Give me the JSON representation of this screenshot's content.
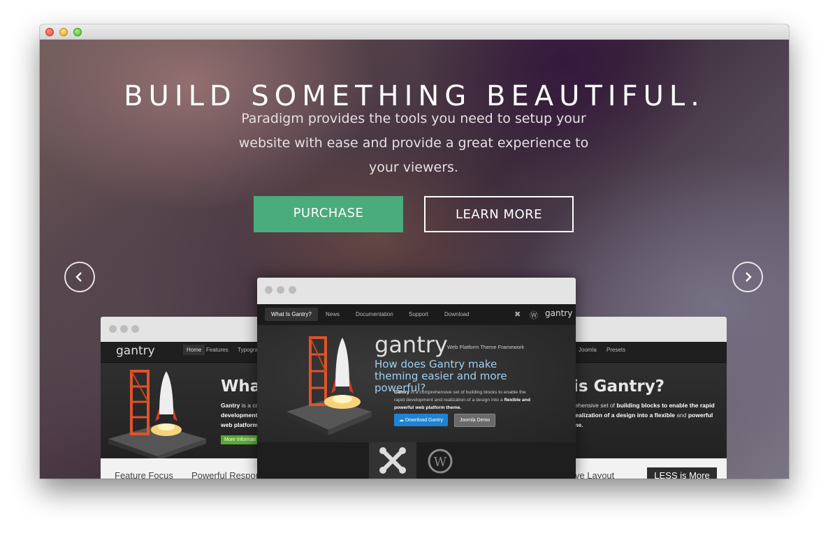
{
  "hero": {
    "headline": "BUILD SOMETHING BEAUTIFUL.",
    "subtext": "Paradigm provides the tools you need to setup your website with ease and provide a great experience to your viewers.",
    "purchase_label": "PURCHASE",
    "learn_more_label": "LEARN MORE",
    "prev_icon": "chevron-left-icon",
    "next_icon": "chevron-right-icon"
  },
  "colors": {
    "purchase_button": "#4aab7c",
    "headline_text": "#ffffff"
  },
  "center_mock": {
    "nav": [
      "What Is Gantry?",
      "News",
      "Documentation",
      "Support",
      "Download"
    ],
    "brand": "gantry",
    "logo": "gantry",
    "tagline": "Web Platform Theme Framework",
    "question": "How does Gantry make theming easier and more powerful?",
    "para_bold1": "Gantry",
    "para_text1": " is a comprehensive set of building blocks to enable the rapid development and realization of a design into a ",
    "para_bold2": "flexible and powerful web platform theme.",
    "download_label": "Download Gantry",
    "demo_label": "Joomla Demo"
  },
  "side_mock": {
    "logo": "gantry",
    "nav_left": [
      "Home",
      "Features",
      "Typograp"
    ],
    "nav_right": [
      "Joomla",
      "Presets"
    ],
    "heading_left": "Wha",
    "heading_right": "is Gantry?",
    "para_left_bold": "Gantry",
    "para_left_text": " is a co",
    "para_left_line2": "development",
    "para_left_line3": "web platform",
    "para_right_line1_text": "rehensive set of ",
    "para_right_line1_bold": "building blocks to enable the rapid",
    "para_right_line2_bold": "realization of a design into a flexible",
    "para_right_line2_text": " and ",
    "para_right_line2_bold2": "powerful",
    "para_right_line3": "me.",
    "more_info_label": "More Informati",
    "footer_left1": "Feature Focus",
    "footer_left2": "Powerful Respon",
    "footer_right": "ive Layout",
    "less_label": "LESS is More"
  }
}
